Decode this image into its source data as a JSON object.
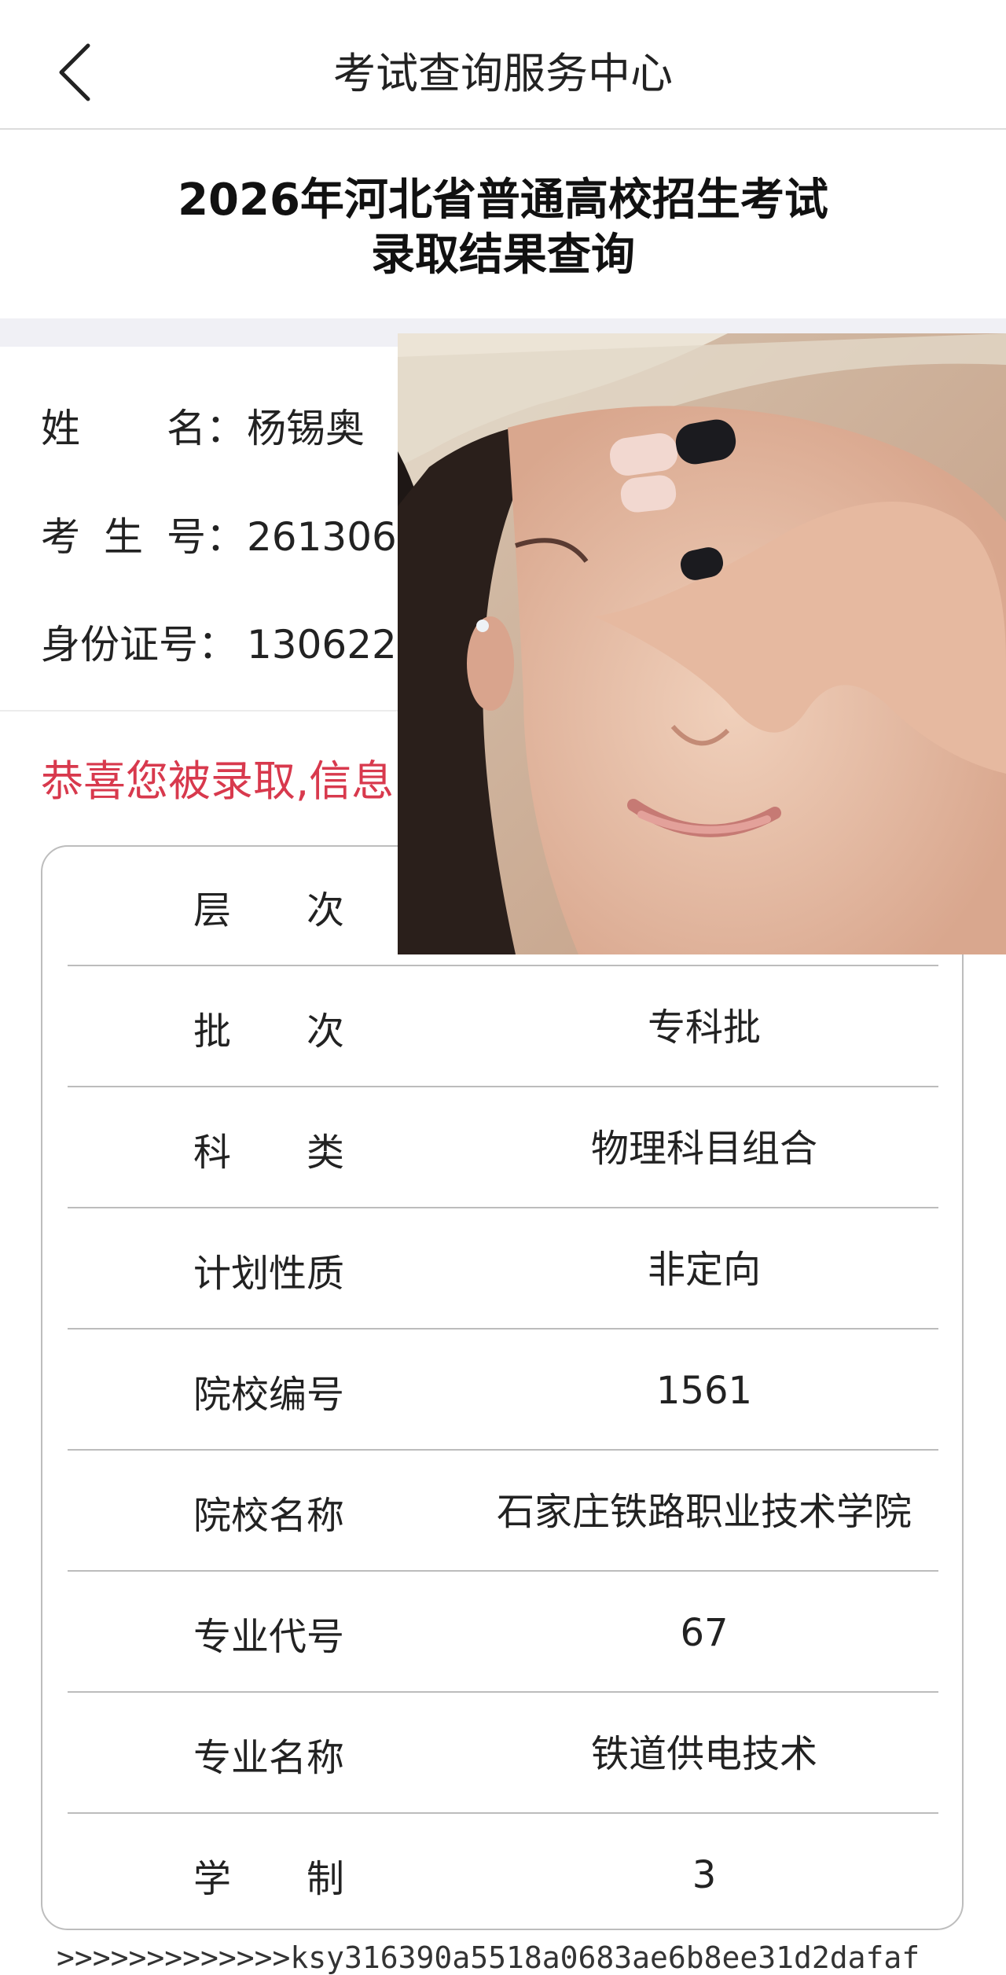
{
  "header": {
    "title": "考试查询服务中心",
    "back_icon": "chevron-left-icon"
  },
  "page_title": {
    "line1": "2026年河北省普通高校招生考试",
    "line2": "录取结果查询"
  },
  "student": {
    "name_label": [
      "姓",
      "名"
    ],
    "name_colon": "：",
    "name_value": "杨锡奥",
    "exam_label": [
      "考",
      "生",
      "号"
    ],
    "exam_colon": "：",
    "exam_value": "2613060",
    "id_label": "身份证号",
    "id_colon": "：",
    "id_value": "130622*"
  },
  "congrats_text": "恭喜您被录取,信息",
  "result_table": {
    "rows": [
      {
        "label": "层　　次",
        "value": ""
      },
      {
        "label": "批　　次",
        "value": "专科批"
      },
      {
        "label": "科　　类",
        "value": "物理科目组合"
      },
      {
        "label": "计划性质",
        "value": "非定向"
      },
      {
        "label": "院校编号",
        "value": "1561"
      },
      {
        "label": "院校名称",
        "value": "石家庄铁路职业技术学院"
      },
      {
        "label": "专业代号",
        "value": "67"
      },
      {
        "label": "专业名称",
        "value": "铁道供电技术"
      },
      {
        "label": "学　　制",
        "value": "3"
      }
    ]
  },
  "footer": {
    "hash_text": ">>>>>>>>>>>>>ksy316390a5518a0683ae6b8ee31d2dafaf"
  },
  "overlay_photo": {
    "icon": "photo-person-covering-eyes",
    "skin": "#e8c2a8",
    "hair": "#1e1715",
    "nail_dark": "#1b1b1f",
    "nail_light": "#f2d8d0"
  }
}
